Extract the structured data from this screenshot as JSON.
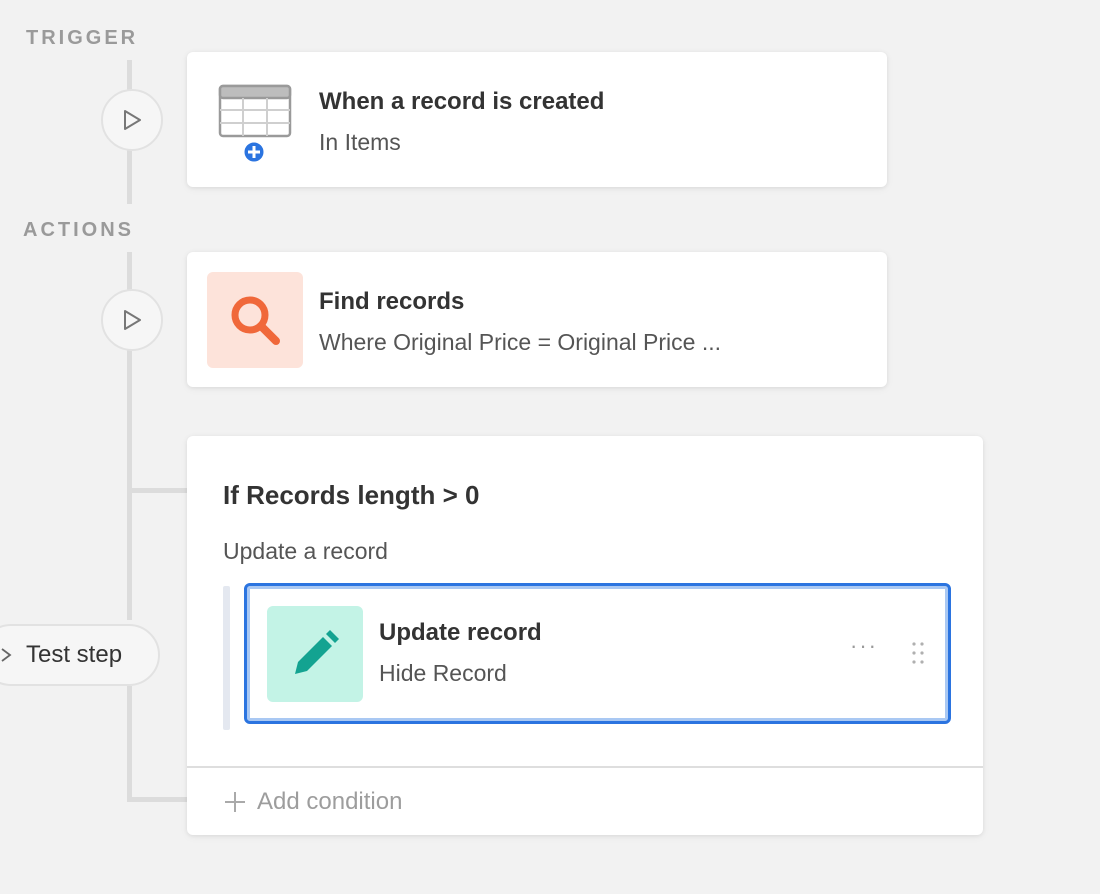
{
  "sections": {
    "trigger_label": "TRIGGER",
    "actions_label": "ACTIONS"
  },
  "trigger": {
    "title": "When a record is created",
    "subtitle": "In Items",
    "icon": "table-plus-icon"
  },
  "find_step": {
    "title": "Find records",
    "subtitle": "Where Original Price = Original Price ...",
    "icon": "search-icon"
  },
  "condition": {
    "title": "If Records length > 0",
    "branch_label": "Update a record",
    "add_condition_label": "Add condition",
    "step": {
      "title": "Update record",
      "subtitle": "Hide Record",
      "icon": "pencil-icon"
    }
  },
  "test_step_label": "Test step",
  "colors": {
    "accent_blue": "#2b74e0",
    "search_tile": "#fde3da",
    "search_icon": "#f0683a",
    "pencil_tile": "#c3f3e6",
    "pencil_icon": "#13a391"
  }
}
